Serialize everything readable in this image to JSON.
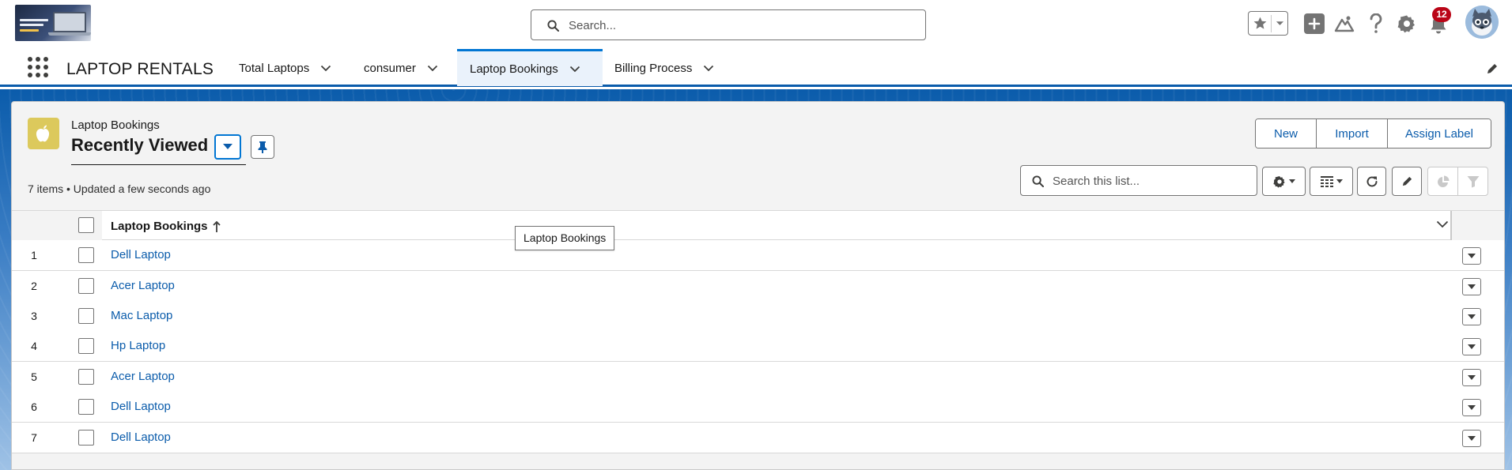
{
  "header": {
    "search": {
      "placeholder": "Search..."
    },
    "notifications": {
      "count": "12"
    }
  },
  "app": {
    "name": "LAPTOP RENTALS",
    "tabs": [
      {
        "label": "Total Laptops",
        "active": false
      },
      {
        "label": "consumer",
        "active": false
      },
      {
        "label": "Laptop Bookings",
        "active": true
      },
      {
        "label": "Billing Process",
        "active": false
      }
    ]
  },
  "list_view": {
    "object_label": "Laptop Bookings",
    "title": "Recently Viewed",
    "meta": "7 items • Updated a few seconds ago",
    "actions": {
      "new": "New",
      "import": "Import",
      "assign_label": "Assign Label"
    },
    "search": {
      "placeholder": "Search this list..."
    },
    "column": {
      "title": "Laptop Bookings"
    },
    "tooltip": "Laptop Bookings",
    "rows": [
      {
        "num": "1",
        "name": "Dell Laptop"
      },
      {
        "num": "2",
        "name": "Acer Laptop"
      },
      {
        "num": "3",
        "name": "Mac Laptop"
      },
      {
        "num": "4",
        "name": "Hp Laptop"
      },
      {
        "num": "5",
        "name": "Acer Laptop"
      },
      {
        "num": "6",
        "name": "Dell Laptop"
      },
      {
        "num": "7",
        "name": "Dell Laptop"
      }
    ]
  },
  "colors": {
    "brand": "#0176d3",
    "link": "#0b5cab",
    "badge": "#ba0517",
    "object_icon": "#dcc95c"
  }
}
